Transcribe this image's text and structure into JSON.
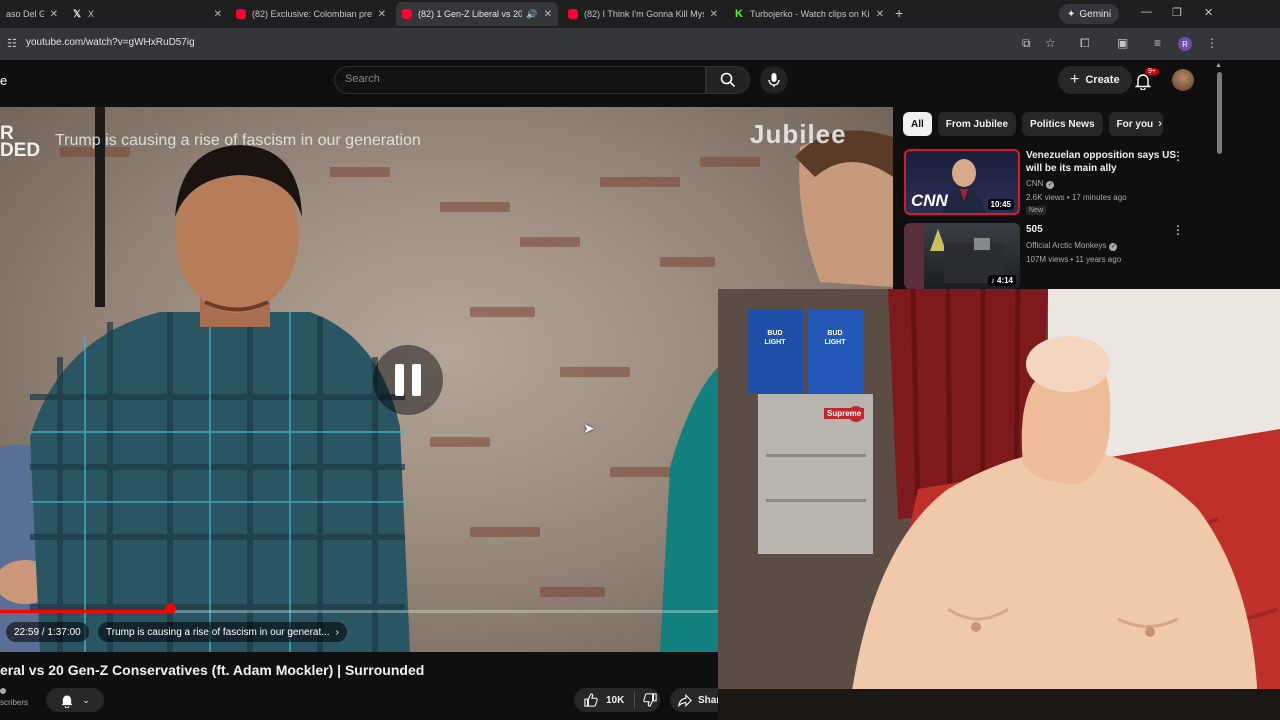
{
  "browser": {
    "tabs": [
      {
        "title": "aso Del Gi",
        "favicon": "generic",
        "active": false
      },
      {
        "title": "X",
        "favicon": "x-logo",
        "active": false
      },
      {
        "title": "(82) Exclusive: Colombian presi",
        "favicon": "youtube",
        "active": false
      },
      {
        "title": "(82) 1 Gen-Z Liberal vs 20 G",
        "favicon": "youtube",
        "active": true,
        "audio": true
      },
      {
        "title": "(82) I Think I'm Gonna Kill Mys",
        "favicon": "youtube",
        "active": false
      },
      {
        "title": "Turbojerko - Watch clips on Ki",
        "favicon": "kick",
        "active": false
      }
    ],
    "gemini_label": "Gemini",
    "url": "youtube.com/watch?v=gWHxRuD57ig",
    "profile_initial": "R"
  },
  "youtube": {
    "logo_fragment": "e",
    "search_placeholder": "Search",
    "create_label": "Create",
    "notification_badge": "9+",
    "colors": {
      "accent": "#ff0000",
      "background": "#0f0f0f",
      "chip_bg": "#272727"
    }
  },
  "player": {
    "brand_fragment_1": "R",
    "brand_fragment_2": "DED",
    "topic_overlay": "Trump is causing a rise of fascism in our generation",
    "watermark": "Jubilee",
    "state": "paused-icon-shown",
    "time": "22:59 / 1:37:00",
    "progress_fraction": 0.237,
    "chapter": "Trump is causing a rise of fascism in our generat...",
    "chapter_arrow": "›"
  },
  "video_info": {
    "title": "eral vs 20 Gen-Z Conservatives (ft. Adam Mockler) | Surrounded",
    "subscribers_fragment": "scribers",
    "likes": "10K",
    "share_label": "Shar"
  },
  "sidebar": {
    "chips": [
      "All",
      "From Jubilee",
      "Politics News",
      "For you"
    ],
    "recommendations": [
      {
        "title": "Venezuelan opposition says US will be its main ally",
        "channel": "CNN",
        "verified": true,
        "meta": "2.6K views • 17 minutes ago",
        "badge": "New",
        "duration": "10:45",
        "thumb_text": "CNN"
      },
      {
        "title": "505",
        "channel": "Official Arctic Monkeys",
        "verified": true,
        "meta": "107M views • 11 years ago",
        "duration": "4:14",
        "thumb_text": ""
      }
    ]
  },
  "webcam": {
    "sign_text": "Supreme",
    "box_text_1": "BUD LIGHT",
    "box_text_2": "BUD LIGHT"
  }
}
